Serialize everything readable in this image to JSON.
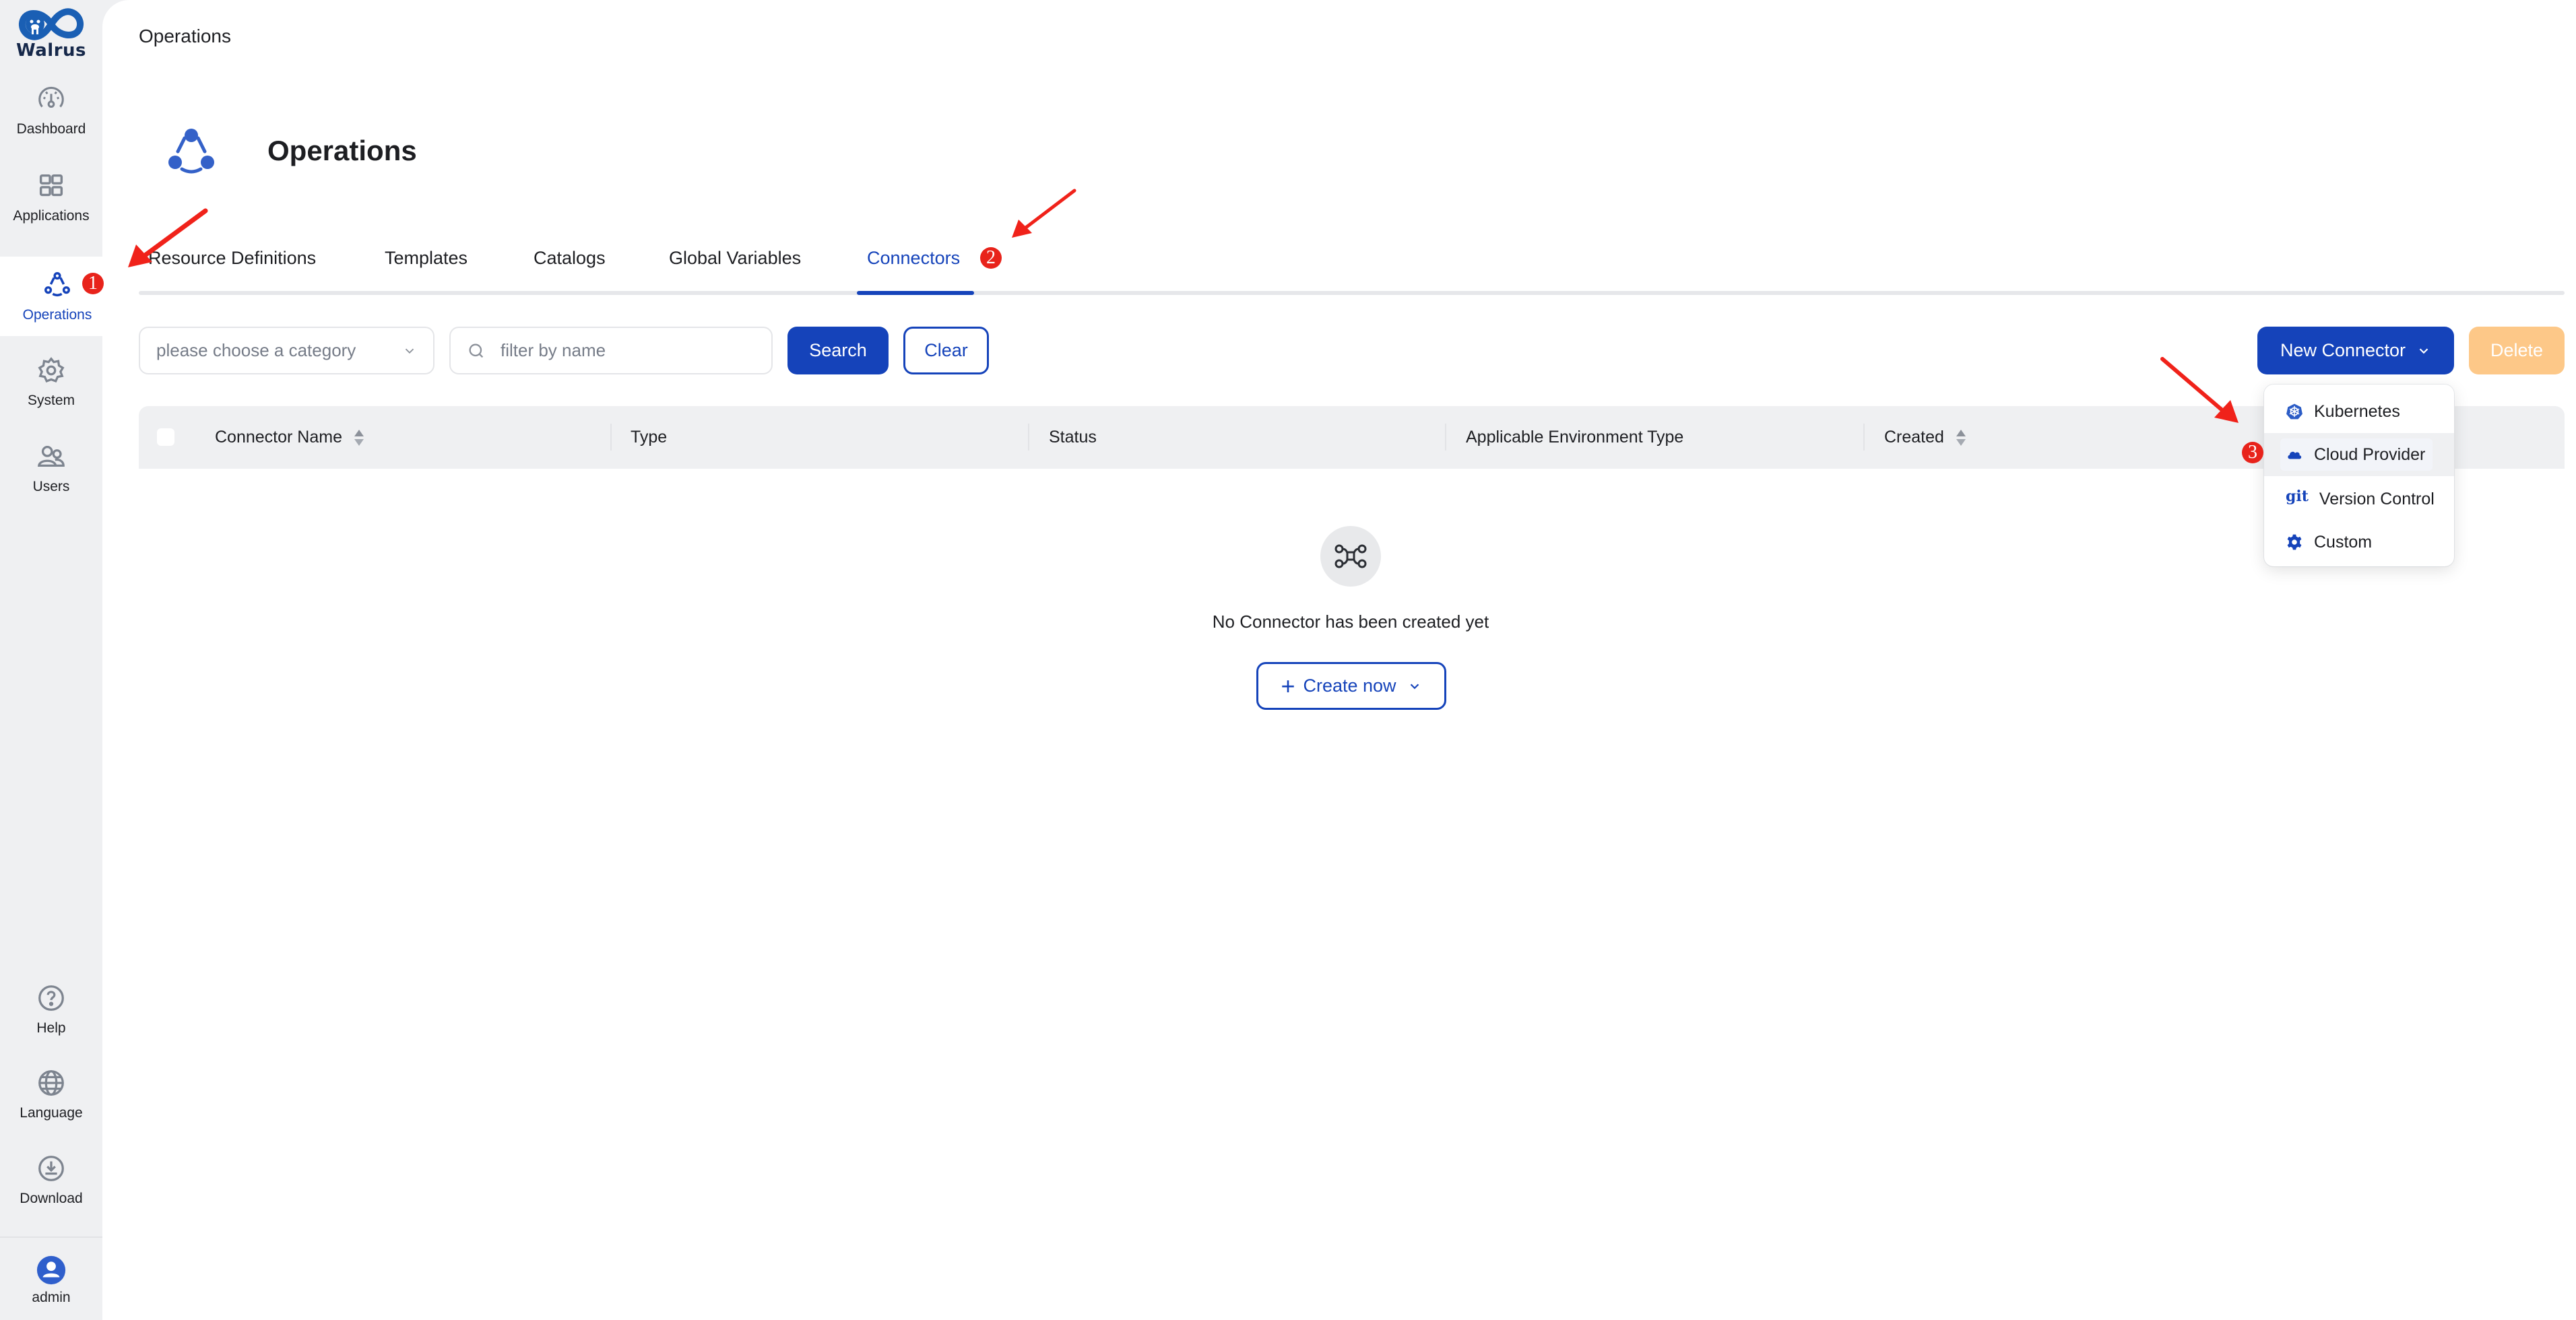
{
  "app": {
    "name": "Walrus"
  },
  "sidebar": {
    "items": [
      {
        "label": "Dashboard",
        "icon": "dashboard-icon",
        "active": false
      },
      {
        "label": "Applications",
        "icon": "applications-icon",
        "active": false
      },
      {
        "label": "Operations",
        "icon": "operations-icon",
        "active": true
      },
      {
        "label": "System",
        "icon": "gear-icon",
        "active": false
      },
      {
        "label": "Users",
        "icon": "users-icon",
        "active": false
      }
    ],
    "bottom_items": [
      {
        "label": "Help",
        "icon": "help-icon"
      },
      {
        "label": "Language",
        "icon": "globe-icon"
      },
      {
        "label": "Download",
        "icon": "download-icon"
      }
    ],
    "user": {
      "label": "admin",
      "icon": "avatar-icon"
    }
  },
  "header": {
    "breadcrumb": "Operations",
    "title": "Operations",
    "icon": "operations-icon"
  },
  "tabs": [
    {
      "label": "Resource Definitions",
      "active": false
    },
    {
      "label": "Templates",
      "active": false
    },
    {
      "label": "Catalogs",
      "active": false
    },
    {
      "label": "Global Variables",
      "active": false
    },
    {
      "label": "Connectors",
      "active": true
    }
  ],
  "filters": {
    "category_placeholder": "please choose a category",
    "search_placeholder": "filter by name",
    "search_value": "",
    "search_button": "Search",
    "clear_button": "Clear"
  },
  "actions": {
    "new_connector": "New Connector",
    "delete": "Delete"
  },
  "table": {
    "columns": [
      {
        "label": "Connector Name",
        "sortable": true
      },
      {
        "label": "Type",
        "sortable": false
      },
      {
        "label": "Status",
        "sortable": false
      },
      {
        "label": "Applicable Environment Type",
        "sortable": false
      },
      {
        "label": "Created",
        "sortable": true
      }
    ],
    "rows": []
  },
  "empty_state": {
    "message": "No Connector has been created yet",
    "create_button": "Create now"
  },
  "new_connector_menu": {
    "items": [
      {
        "label": "Kubernetes",
        "icon": "kubernetes-icon"
      },
      {
        "label": "Cloud Provider",
        "icon": "cloud-icon",
        "hovered": true
      },
      {
        "label": "Version Control",
        "icon": "git-icon",
        "icon_text": "git"
      },
      {
        "label": "Custom",
        "icon": "gear-icon"
      }
    ]
  },
  "annotations": [
    {
      "number": "1",
      "target": "Operations sidebar item"
    },
    {
      "number": "2",
      "target": "Connectors tab"
    },
    {
      "number": "3",
      "target": "Cloud Provider menu item"
    }
  ],
  "colors": {
    "primary": "#1543ba",
    "delete_disabled": "#fdc888",
    "sidebar_bg": "#eff0f2",
    "annotation": "#e8231b"
  }
}
